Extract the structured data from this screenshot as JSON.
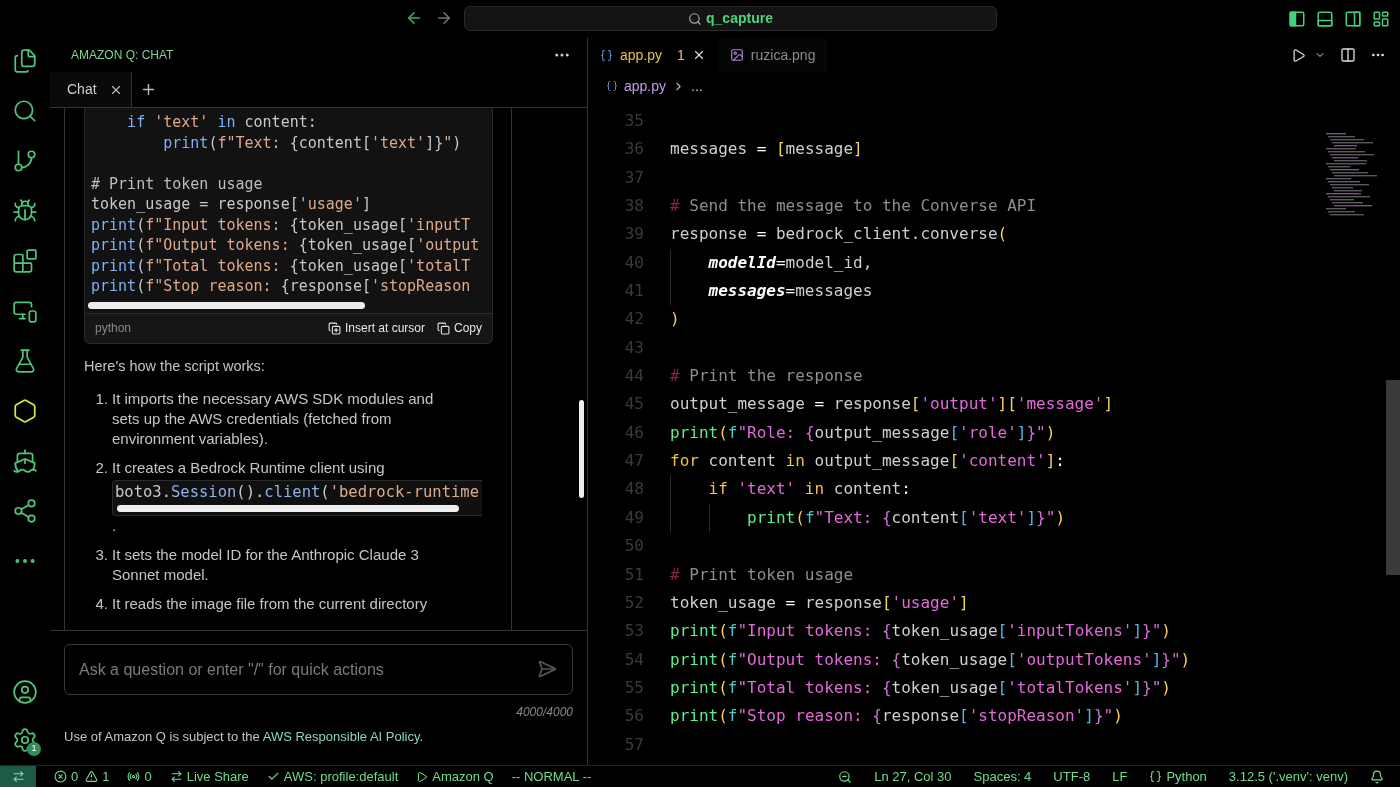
{
  "title_bar": {
    "search": "q_capture",
    "layout_toggles": [
      {
        "kind": "left",
        "on": true
      },
      {
        "kind": "bottom",
        "on": false
      },
      {
        "kind": "right",
        "on": false
      },
      {
        "kind": "custom",
        "on": false
      }
    ]
  },
  "activity_bar": {
    "items": [
      {
        "kind": "files",
        "selected": false
      },
      {
        "kind": "search",
        "selected": false
      },
      {
        "kind": "source-control",
        "selected": false
      },
      {
        "kind": "run",
        "selected": false
      },
      {
        "kind": "extensions",
        "selected": false
      },
      {
        "kind": "remote",
        "selected": false
      },
      {
        "kind": "testing",
        "selected": false
      },
      {
        "kind": "amazon-q",
        "selected": true
      },
      {
        "kind": "docker",
        "selected": false
      },
      {
        "kind": "live-share",
        "selected": false
      },
      {
        "kind": "more",
        "selected": false
      }
    ],
    "bottom": [
      {
        "kind": "account"
      },
      {
        "kind": "settings",
        "badge": "1"
      }
    ]
  },
  "chat_panel": {
    "title": "AMAZON Q: CHAT",
    "tabs": [
      {
        "label": "Chat",
        "selected": true
      }
    ],
    "code_block": {
      "lines": [
        {
          "kind": "code",
          "tokens": [
            {
              "t": "    if",
              "kind": "kw"
            },
            {
              "t": " 'text' ",
              "kind": "str"
            },
            {
              "t": "in",
              "kind": "kw"
            },
            {
              "t": " content:",
              "kind": "plain"
            }
          ]
        },
        {
          "kind": "code",
          "tokens": [
            {
              "t": "        print",
              "kind": "kw"
            },
            {
              "t": "(",
              "kind": "plain"
            },
            {
              "t": "f\"Text: ",
              "kind": "str"
            },
            {
              "t": "{content[",
              "kind": "plain"
            },
            {
              "t": "'text'",
              "kind": "str"
            },
            {
              "t": "]}",
              "kind": "plain"
            },
            {
              "t": "\"",
              "kind": "str"
            },
            {
              "t": ")",
              "kind": "plain"
            }
          ]
        },
        {
          "kind": "blank"
        },
        {
          "kind": "code",
          "tokens": [
            {
              "t": "# Print token usage",
              "kind": "com"
            }
          ]
        },
        {
          "kind": "code",
          "tokens": [
            {
              "t": "token_usage = response[",
              "kind": "plain"
            },
            {
              "t": "'usage'",
              "kind": "str"
            },
            {
              "t": "]",
              "kind": "plain"
            }
          ]
        },
        {
          "kind": "code",
          "tokens": [
            {
              "t": "print",
              "kind": "kw"
            },
            {
              "t": "(",
              "kind": "plain"
            },
            {
              "t": "f\"Input tokens: ",
              "kind": "str"
            },
            {
              "t": "{token_usage[",
              "kind": "plain"
            },
            {
              "t": "'inputT",
              "kind": "str"
            }
          ]
        },
        {
          "kind": "code",
          "tokens": [
            {
              "t": "print",
              "kind": "kw"
            },
            {
              "t": "(",
              "kind": "plain"
            },
            {
              "t": "f\"Output tokens: ",
              "kind": "str"
            },
            {
              "t": "{token_usage[",
              "kind": "plain"
            },
            {
              "t": "'output",
              "kind": "str"
            }
          ]
        },
        {
          "kind": "code",
          "tokens": [
            {
              "t": "print",
              "kind": "kw"
            },
            {
              "t": "(",
              "kind": "plain"
            },
            {
              "t": "f\"Total tokens: ",
              "kind": "str"
            },
            {
              "t": "{token_usage[",
              "kind": "plain"
            },
            {
              "t": "'totalT",
              "kind": "str"
            }
          ]
        },
        {
          "kind": "code",
          "tokens": [
            {
              "t": "print",
              "kind": "kw"
            },
            {
              "t": "(",
              "kind": "plain"
            },
            {
              "t": "f\"Stop reason: ",
              "kind": "str"
            },
            {
              "t": "{response[",
              "kind": "plain"
            },
            {
              "t": "'stopReason",
              "kind": "str"
            }
          ]
        }
      ],
      "language": "python",
      "actions": [
        {
          "kind": "insert",
          "label": "Insert at cursor"
        },
        {
          "kind": "copy",
          "label": "Copy"
        }
      ]
    },
    "intro": "Here's how the script works:",
    "steps": [
      {
        "number": "1.",
        "text": "It imports the necessary AWS SDK modules and sets up the AWS credentials (fetched from environment variables)."
      },
      {
        "number": "2.",
        "text": "It creates a Bedrock Runtime client using",
        "code": [
          {
            "t": "boto3.",
            "kind": "plain"
          },
          {
            "t": "Session",
            "kind": "cls"
          },
          {
            "t": "().",
            "kind": "plain"
          },
          {
            "t": "client",
            "kind": "cls"
          },
          {
            "t": "(",
            "kind": "plain"
          },
          {
            "t": "'bedrock-runtime",
            "kind": "str"
          }
        ],
        "after": "."
      },
      {
        "number": "3.",
        "text": "It sets the model ID for the Anthropic Claude 3 Sonnet model."
      },
      {
        "number": "4.",
        "text": "It reads the image file from the current directory"
      }
    ],
    "input": {
      "placeholder": "Ask a question or enter \"/\" for quick actions"
    },
    "counter": "4000/4000",
    "footer": {
      "before": "Use of Amazon Q is subject to the ",
      "link": "AWS Responsible AI Policy",
      "after": "."
    }
  },
  "editor": {
    "tabs": [
      {
        "label": "app.py",
        "kind": "python",
        "problems": "1",
        "selected": true
      },
      {
        "label": "ruzica.png",
        "kind": "image",
        "selected": false
      }
    ],
    "breadcrumb": [
      "app.py",
      "..."
    ],
    "lines": [
      {
        "number": "35"
      },
      {
        "number": "36",
        "tokens": [
          {
            "t": "messages",
            "kind": "plain"
          },
          {
            "t": " = ",
            "kind": "op"
          },
          {
            "t": "[",
            "kind": "br1"
          },
          {
            "t": "message",
            "kind": "plain"
          },
          {
            "t": "]",
            "kind": "br1"
          }
        ]
      },
      {
        "number": "37"
      },
      {
        "number": "38",
        "tokens": [
          {
            "t": "#",
            "kind": "hash"
          },
          {
            "t": " Send the message to the Converse API",
            "kind": "com"
          }
        ]
      },
      {
        "number": "39",
        "tokens": [
          {
            "t": "response",
            "kind": "plain"
          },
          {
            "t": " = ",
            "kind": "op"
          },
          {
            "t": "bedrock_client.converse",
            "kind": "plain"
          },
          {
            "t": "(",
            "kind": "br1"
          }
        ]
      },
      {
        "number": "40",
        "tokens": [
          {
            "t": "    modelId",
            "kind": "param"
          },
          {
            "t": "=",
            "kind": "op"
          },
          {
            "t": "model_id,",
            "kind": "plain"
          }
        ]
      },
      {
        "number": "41",
        "tokens": [
          {
            "t": "    messages",
            "kind": "param"
          },
          {
            "t": "=",
            "kind": "op"
          },
          {
            "t": "messages",
            "kind": "plain"
          }
        ]
      },
      {
        "number": "42",
        "tokens": [
          {
            "t": ")",
            "kind": "br1"
          }
        ]
      },
      {
        "number": "43"
      },
      {
        "number": "44",
        "tokens": [
          {
            "t": "#",
            "kind": "hash"
          },
          {
            "t": " Print the response",
            "kind": "com"
          }
        ]
      },
      {
        "number": "45",
        "tokens": [
          {
            "t": "output_message",
            "kind": "plain"
          },
          {
            "t": " = ",
            "kind": "op"
          },
          {
            "t": "response",
            "kind": "plain"
          },
          {
            "t": "[",
            "kind": "br1"
          },
          {
            "t": "'output'",
            "kind": "str"
          },
          {
            "t": "][",
            "kind": "br1"
          },
          {
            "t": "'message'",
            "kind": "str"
          },
          {
            "t": "]",
            "kind": "br1"
          }
        ]
      },
      {
        "number": "46",
        "tokens": [
          {
            "t": "print",
            "kind": "fn"
          },
          {
            "t": "(",
            "kind": "br1"
          },
          {
            "t": "f",
            "kind": "fpre"
          },
          {
            "t": "\"Role: ",
            "kind": "str"
          },
          {
            "t": "{",
            "kind": "br2"
          },
          {
            "t": "output_message",
            "kind": "plain"
          },
          {
            "t": "[",
            "kind": "br3"
          },
          {
            "t": "'role'",
            "kind": "str"
          },
          {
            "t": "]",
            "kind": "br3"
          },
          {
            "t": "}",
            "kind": "br2"
          },
          {
            "t": "\"",
            "kind": "str"
          },
          {
            "t": ")",
            "kind": "br1"
          }
        ]
      },
      {
        "number": "47",
        "tokens": [
          {
            "t": "for",
            "kind": "kw"
          },
          {
            "t": " content ",
            "kind": "plain"
          },
          {
            "t": "in",
            "kind": "kw"
          },
          {
            "t": " output_message",
            "kind": "plain"
          },
          {
            "t": "[",
            "kind": "br1"
          },
          {
            "t": "'content'",
            "kind": "str"
          },
          {
            "t": "]",
            "kind": "br1"
          },
          {
            "t": ":",
            "kind": "op"
          }
        ]
      },
      {
        "number": "48",
        "tokens": [
          {
            "t": "    if",
            "kind": "kw"
          },
          {
            "t": " 'text' ",
            "kind": "str"
          },
          {
            "t": "in",
            "kind": "kw"
          },
          {
            "t": " content",
            "kind": "plain"
          },
          {
            "t": ":",
            "kind": "op"
          }
        ]
      },
      {
        "number": "49",
        "tokens": [
          {
            "t": "        print",
            "kind": "fn"
          },
          {
            "t": "(",
            "kind": "br1"
          },
          {
            "t": "f",
            "kind": "fpre"
          },
          {
            "t": "\"Text: ",
            "kind": "str"
          },
          {
            "t": "{",
            "kind": "br2"
          },
          {
            "t": "content",
            "kind": "plain"
          },
          {
            "t": "[",
            "kind": "br3"
          },
          {
            "t": "'text'",
            "kind": "str"
          },
          {
            "t": "]",
            "kind": "br3"
          },
          {
            "t": "}",
            "kind": "br2"
          },
          {
            "t": "\"",
            "kind": "str"
          },
          {
            "t": ")",
            "kind": "br1"
          }
        ]
      },
      {
        "number": "50"
      },
      {
        "number": "51",
        "tokens": [
          {
            "t": "#",
            "kind": "hash"
          },
          {
            "t": " Print token usage",
            "kind": "com"
          }
        ]
      },
      {
        "number": "52",
        "tokens": [
          {
            "t": "token_usage",
            "kind": "plain"
          },
          {
            "t": " = ",
            "kind": "op"
          },
          {
            "t": "response",
            "kind": "plain"
          },
          {
            "t": "[",
            "kind": "br1"
          },
          {
            "t": "'usage'",
            "kind": "str"
          },
          {
            "t": "]",
            "kind": "br1"
          }
        ]
      },
      {
        "number": "53",
        "tokens": [
          {
            "t": "print",
            "kind": "fn"
          },
          {
            "t": "(",
            "kind": "br1"
          },
          {
            "t": "f",
            "kind": "fpre"
          },
          {
            "t": "\"Input tokens: ",
            "kind": "str"
          },
          {
            "t": "{",
            "kind": "br2"
          },
          {
            "t": "token_usage",
            "kind": "plain"
          },
          {
            "t": "[",
            "kind": "br3"
          },
          {
            "t": "'inputTokens'",
            "kind": "str"
          },
          {
            "t": "]",
            "kind": "br3"
          },
          {
            "t": "}",
            "kind": "br2"
          },
          {
            "t": "\"",
            "kind": "str"
          },
          {
            "t": ")",
            "kind": "br1"
          }
        ]
      },
      {
        "number": "54",
        "tokens": [
          {
            "t": "print",
            "kind": "fn"
          },
          {
            "t": "(",
            "kind": "br1"
          },
          {
            "t": "f",
            "kind": "fpre"
          },
          {
            "t": "\"Output tokens: ",
            "kind": "str"
          },
          {
            "t": "{",
            "kind": "br2"
          },
          {
            "t": "token_usage",
            "kind": "plain"
          },
          {
            "t": "[",
            "kind": "br3"
          },
          {
            "t": "'outputTokens'",
            "kind": "str"
          },
          {
            "t": "]",
            "kind": "br3"
          },
          {
            "t": "}",
            "kind": "br2"
          },
          {
            "t": "\"",
            "kind": "str"
          },
          {
            "t": ")",
            "kind": "br1"
          }
        ]
      },
      {
        "number": "55",
        "tokens": [
          {
            "t": "print",
            "kind": "fn"
          },
          {
            "t": "(",
            "kind": "br1"
          },
          {
            "t": "f",
            "kind": "fpre"
          },
          {
            "t": "\"Total tokens: ",
            "kind": "str"
          },
          {
            "t": "{",
            "kind": "br2"
          },
          {
            "t": "token_usage",
            "kind": "plain"
          },
          {
            "t": "[",
            "kind": "br3"
          },
          {
            "t": "'totalTokens'",
            "kind": "str"
          },
          {
            "t": "]",
            "kind": "br3"
          },
          {
            "t": "}",
            "kind": "br2"
          },
          {
            "t": "\"",
            "kind": "str"
          },
          {
            "t": ")",
            "kind": "br1"
          }
        ]
      },
      {
        "number": "56",
        "tokens": [
          {
            "t": "print",
            "kind": "fn"
          },
          {
            "t": "(",
            "kind": "br1"
          },
          {
            "t": "f",
            "kind": "fpre"
          },
          {
            "t": "\"Stop reason: ",
            "kind": "str"
          },
          {
            "t": "{",
            "kind": "br2"
          },
          {
            "t": "response",
            "kind": "plain"
          },
          {
            "t": "[",
            "kind": "br3"
          },
          {
            "t": "'stopReason'",
            "kind": "str"
          },
          {
            "t": "]",
            "kind": "br3"
          },
          {
            "t": "}",
            "kind": "br2"
          },
          {
            "t": "\"",
            "kind": "str"
          },
          {
            "t": ")",
            "kind": "br1"
          }
        ]
      },
      {
        "number": "57"
      }
    ]
  },
  "status_bar": {
    "left": [
      {
        "kind": "problems",
        "errors": "0",
        "warnings": "1"
      },
      {
        "kind": "ports",
        "text": "0"
      },
      {
        "kind": "live-share",
        "text": "Live Share"
      },
      {
        "kind": "check",
        "text": "AWS: profile:default"
      },
      {
        "kind": "play",
        "text": "Amazon Q"
      },
      {
        "kind": "text",
        "text": "-- NORMAL --"
      }
    ],
    "right": [
      {
        "kind": "zoom"
      },
      {
        "kind": "text",
        "text": "Ln 27, Col 30"
      },
      {
        "kind": "text",
        "text": "Spaces: 4"
      },
      {
        "kind": "text",
        "text": "UTF-8"
      },
      {
        "kind": "text",
        "text": "LF"
      },
      {
        "kind": "language",
        "text": "Python"
      },
      {
        "kind": "text",
        "text": "3.12.5 ('.venv': venv)"
      },
      {
        "kind": "bell"
      }
    ]
  }
}
